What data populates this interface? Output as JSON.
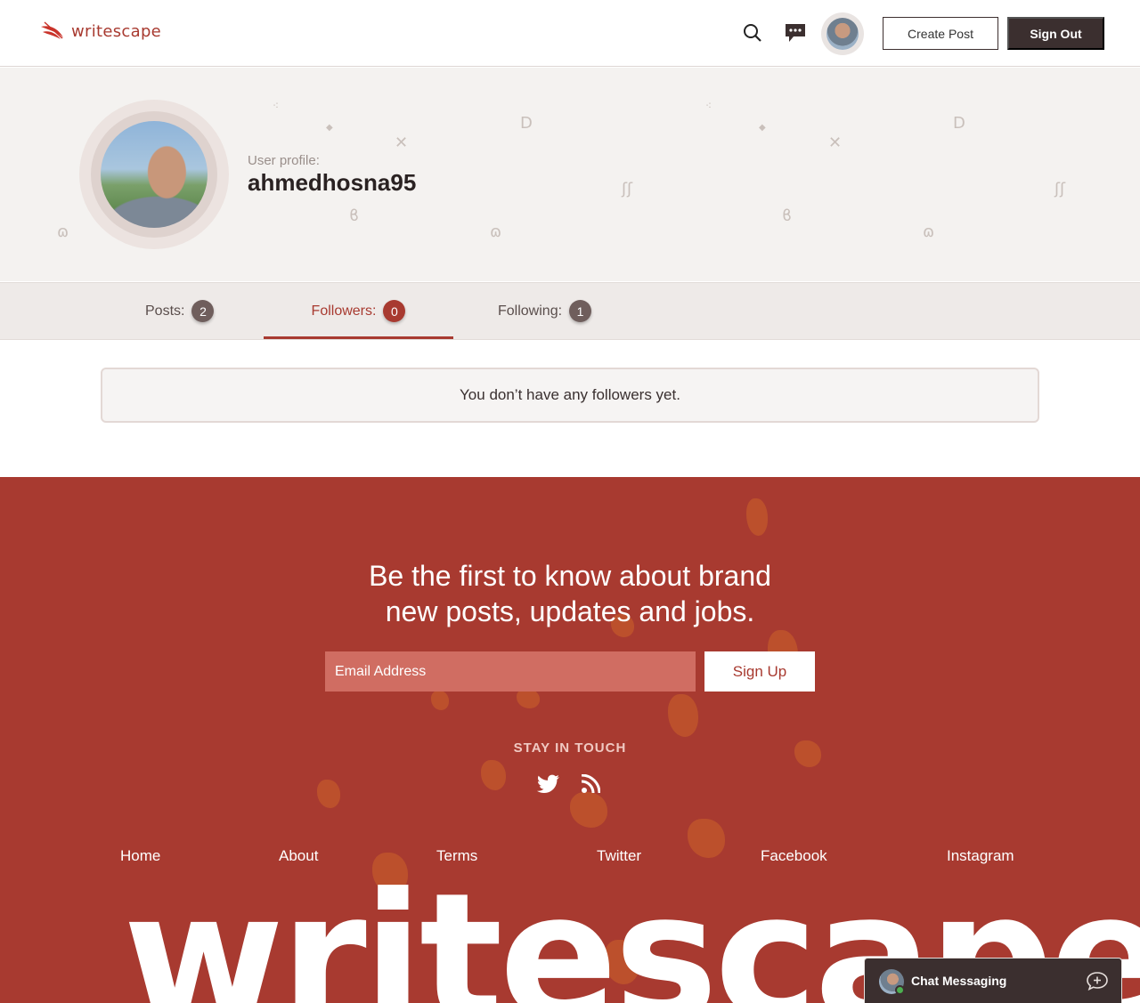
{
  "brand": {
    "name": "writescape",
    "accent": "#a83a30",
    "dark": "#3b2f2f"
  },
  "header": {
    "search_icon": "search-icon",
    "messages_icon": "chat-dots-icon",
    "create_post_label": "Create Post",
    "sign_out_label": "Sign Out"
  },
  "profile": {
    "label": "User profile:",
    "username": "ahmedhosna95"
  },
  "tabs": [
    {
      "label": "Posts:",
      "count": "2",
      "active": false
    },
    {
      "label": "Followers:",
      "count": "0",
      "active": true
    },
    {
      "label": "Following:",
      "count": "1",
      "active": false
    }
  ],
  "followers": {
    "empty_message": "You don’t have any followers yet."
  },
  "footer": {
    "newsletter_line1": "Be the first to know about brand",
    "newsletter_line2": "new posts, updates and jobs.",
    "email_placeholder": "Email Address",
    "signup_label": "Sign Up",
    "stay_in_touch": "STAY IN TOUCH",
    "social_icons": [
      "twitter-icon",
      "rss-icon"
    ],
    "links": [
      "Home",
      "About",
      "Terms",
      "Twitter",
      "Facebook",
      "Instagram"
    ],
    "wordmark": "writescape"
  },
  "chat": {
    "title": "Chat Messaging",
    "status_color": "#4caf50"
  }
}
